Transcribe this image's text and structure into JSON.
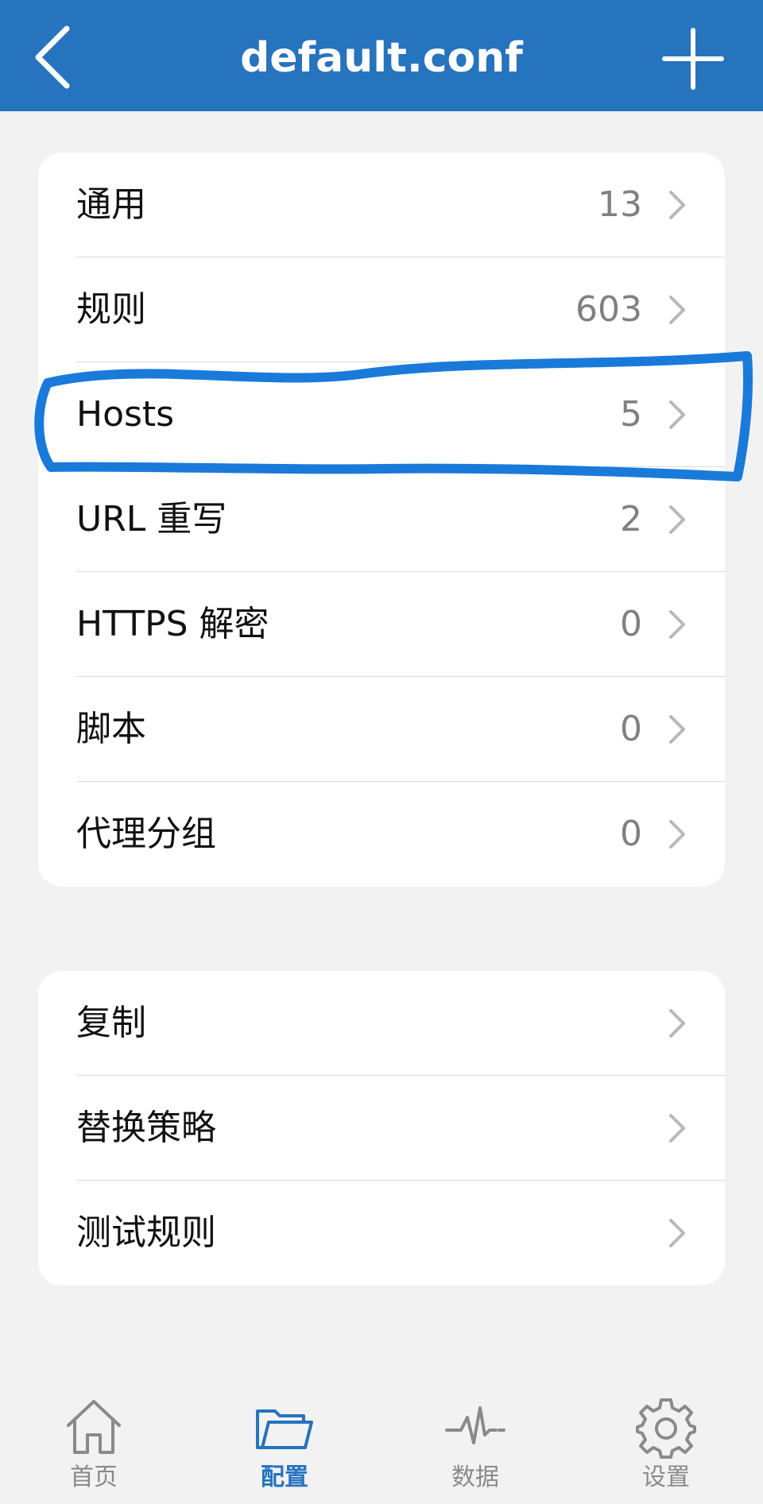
{
  "header": {
    "title": "default.conf",
    "back_icon": "chevron-left-icon",
    "add_icon": "plus-icon"
  },
  "config_items": [
    {
      "label": "通用",
      "count": "13"
    },
    {
      "label": "规则",
      "count": "603"
    },
    {
      "label": "Hosts",
      "count": "5"
    },
    {
      "label": "URL 重写",
      "count": "2"
    },
    {
      "label": "HTTPS 解密",
      "count": "0"
    },
    {
      "label": "脚本",
      "count": "0"
    },
    {
      "label": "代理分组",
      "count": "0"
    }
  ],
  "action_items": [
    {
      "label": "复制"
    },
    {
      "label": "替换策略"
    },
    {
      "label": "测试规则"
    }
  ],
  "tabs": [
    {
      "label": "首页",
      "icon": "home-icon"
    },
    {
      "label": "配置",
      "icon": "folder-icon"
    },
    {
      "label": "数据",
      "icon": "pulse-icon"
    },
    {
      "label": "设置",
      "icon": "gear-icon"
    }
  ],
  "colors": {
    "header_bg": "#2673be",
    "accent": "#2673be",
    "highlight_stroke": "#1a7ad9",
    "background": "#f2f2f2"
  }
}
